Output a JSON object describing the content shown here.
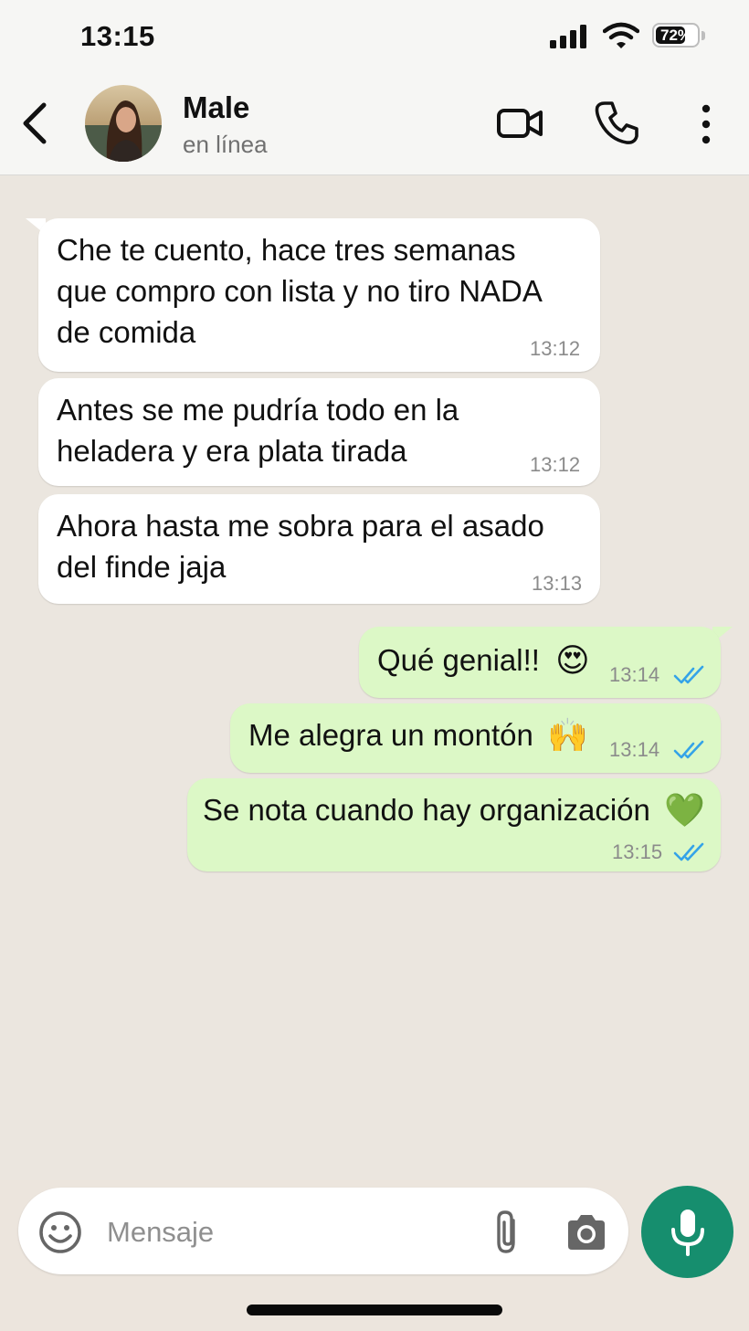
{
  "status_bar": {
    "time": "13:15",
    "battery": "72%",
    "battery_level": 0.72
  },
  "header": {
    "contact_name": "Male",
    "contact_status": "en línea"
  },
  "messages": [
    {
      "direction": "in",
      "lines": [
        "Che te cuento, hace tres semanas",
        "que compro con lista y no tiro NADA",
        "de comida"
      ],
      "time": "13:12"
    },
    {
      "direction": "in",
      "lines": [
        "Antes se me pudría todo en la",
        "heladera y era plata tirada"
      ],
      "time": "13:12"
    },
    {
      "direction": "in",
      "lines": [
        "Ahora hasta me sobra para el asado",
        "del finde jaja"
      ],
      "time": "13:13"
    },
    {
      "direction": "out",
      "text": "Qué genial!!",
      "emoji": "😍",
      "time": "13:14",
      "read": true
    },
    {
      "direction": "out",
      "text": "Me alegra un montón",
      "emoji": "🙌",
      "time": "13:14",
      "read": true
    },
    {
      "direction": "out",
      "text": "Se nota cuando hay organización",
      "emoji": "💚",
      "time": "13:15",
      "read": true
    }
  ],
  "input": {
    "placeholder": "Mensaje"
  },
  "icons": {
    "back": "back-arrow-icon",
    "video": "video-call-icon",
    "call": "phone-icon",
    "menu": "more-vertical-icon",
    "emoji": "emoji-icon",
    "attach": "paperclip-icon",
    "camera": "camera-icon",
    "mic": "microphone-icon",
    "read": "double-check-icon"
  },
  "colors": {
    "accent": "#168e6e",
    "outgoing_bubble": "#dcf8c6",
    "incoming_bubble": "#ffffff",
    "chat_background": "#ebe6df",
    "read_check": "#34a3e8",
    "header_background": "#f6f6f4"
  }
}
